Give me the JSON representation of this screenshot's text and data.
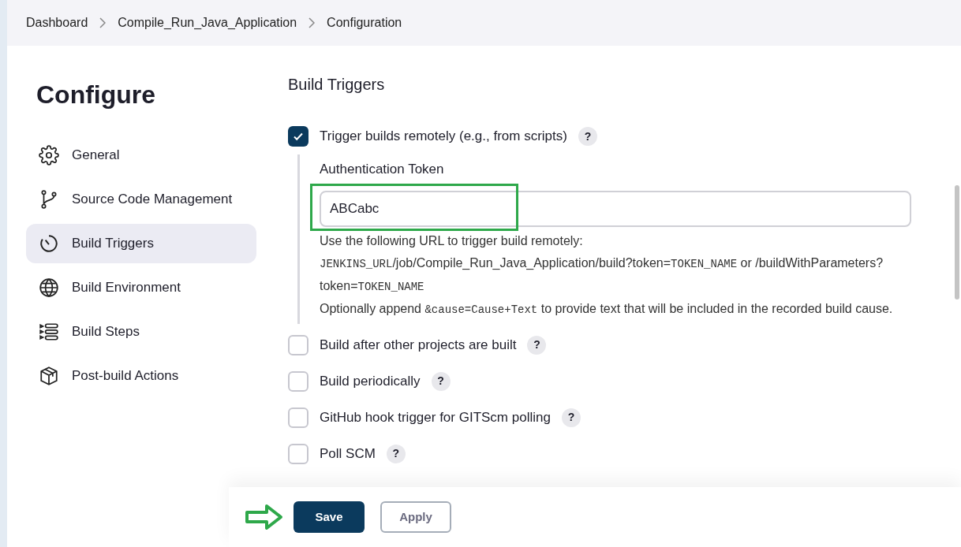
{
  "breadcrumb": [
    {
      "label": "Dashboard"
    },
    {
      "label": "Compile_Run_Java_Application"
    },
    {
      "label": "Configuration"
    }
  ],
  "sidebar": {
    "title": "Configure",
    "items": [
      {
        "label": "General",
        "selected": false
      },
      {
        "label": "Source Code Management",
        "selected": false
      },
      {
        "label": "Build Triggers",
        "selected": true
      },
      {
        "label": "Build Environment",
        "selected": false
      },
      {
        "label": "Build Steps",
        "selected": false
      },
      {
        "label": "Post-build Actions",
        "selected": false
      }
    ]
  },
  "section": {
    "title": "Build Triggers",
    "triggers": [
      {
        "label": "Trigger builds remotely (e.g., from scripts)",
        "checked": true,
        "help": "?",
        "details": {
          "field_label": "Authentication Token",
          "value": "ABCabc",
          "paragraphs": [
            [
              {
                "text": "Use the following URL to trigger build remotely:",
                "mono": false
              }
            ],
            [
              {
                "text": "JENKINS_URL",
                "mono": true
              },
              {
                "text": "/job/Compile_Run_Java_Application/build?token=",
                "mono": false
              },
              {
                "text": "TOKEN_NAME",
                "mono": true
              },
              {
                "text": " or /buildWithParameters?token=",
                "mono": false
              },
              {
                "text": "TOKEN_NAME",
                "mono": true
              }
            ],
            [
              {
                "text": "Optionally append ",
                "mono": false
              },
              {
                "text": "&cause=Cause+Text",
                "mono": true
              },
              {
                "text": " to provide text that will be included in the recorded build cause.",
                "mono": false
              }
            ]
          ]
        }
      },
      {
        "label": "Build after other projects are built",
        "checked": false,
        "help": "?"
      },
      {
        "label": "Build periodically",
        "checked": false,
        "help": "?"
      },
      {
        "label": "GitHub hook trigger for GITScm polling",
        "checked": false,
        "help": "?"
      },
      {
        "label": "Poll SCM",
        "checked": false,
        "help": "?"
      }
    ]
  },
  "buttons": [
    {
      "label": "Save",
      "kind": "primary"
    },
    {
      "label": "Apply",
      "kind": "secondary"
    }
  ]
}
